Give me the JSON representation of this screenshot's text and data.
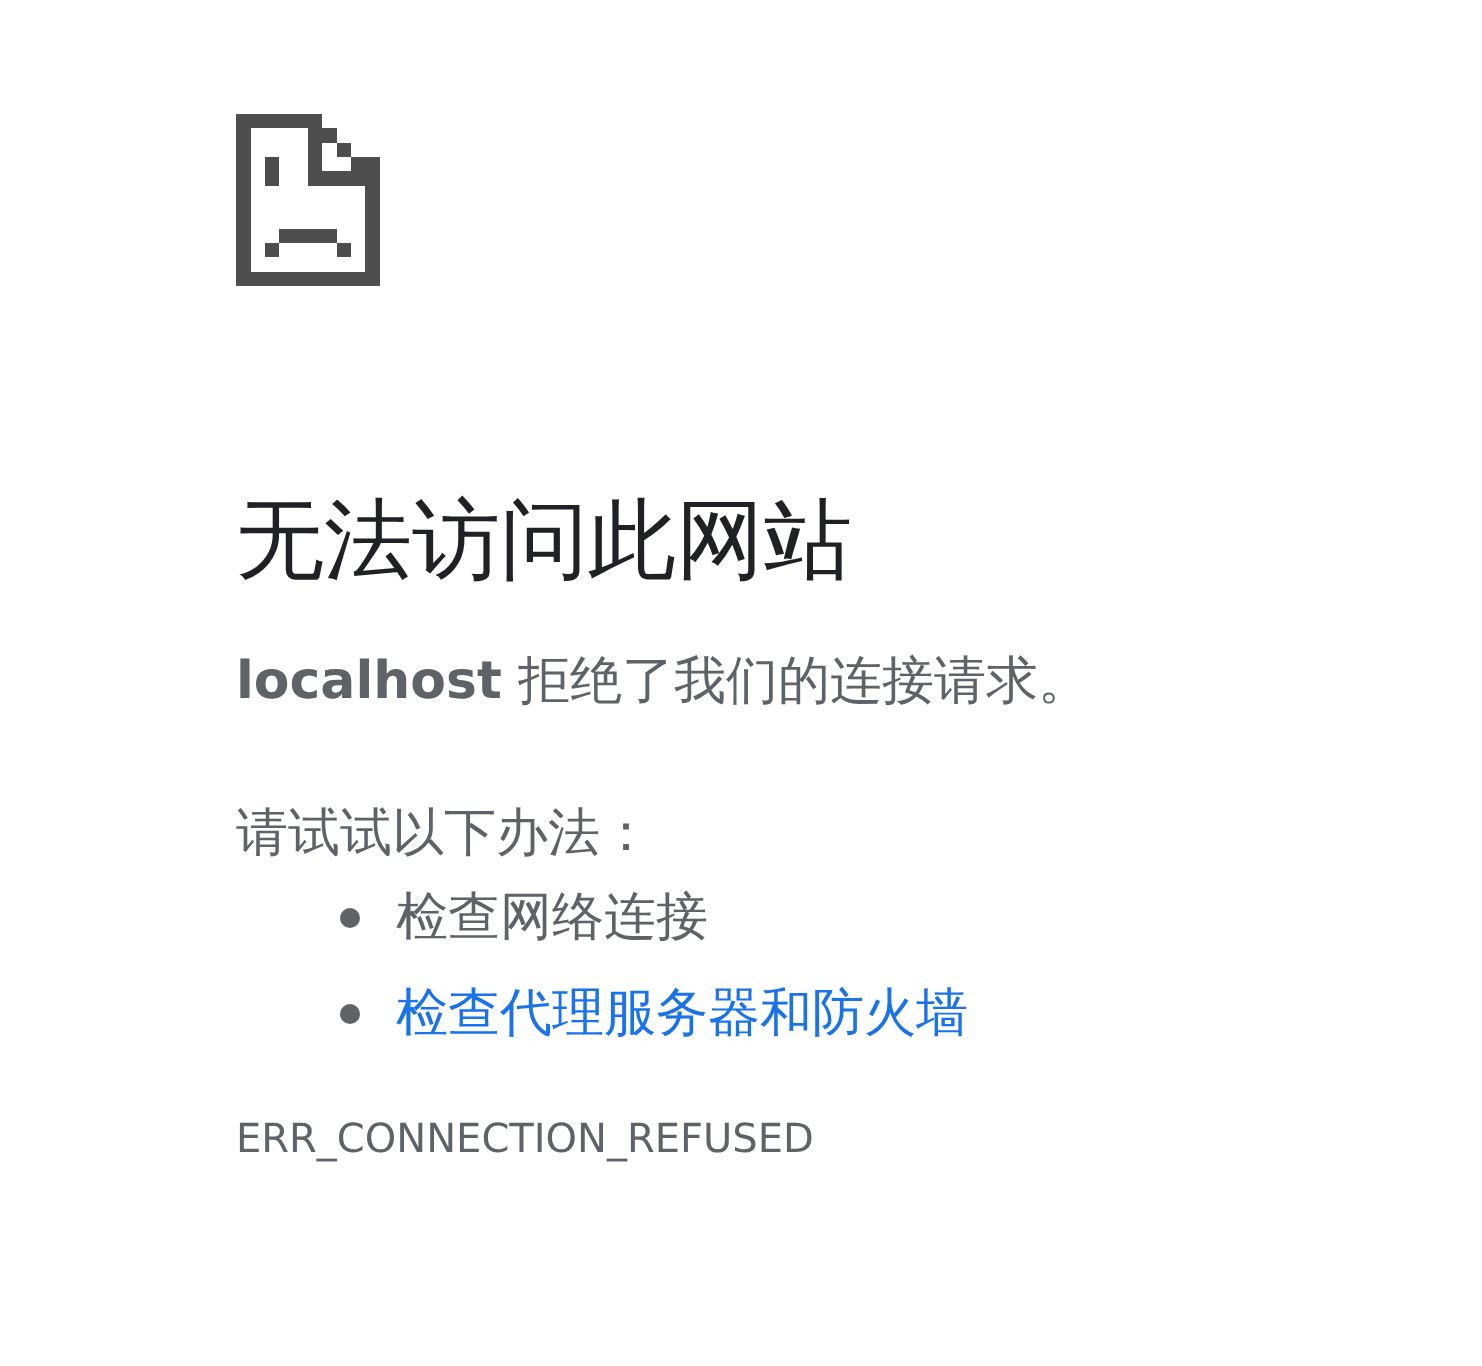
{
  "title": "无法访问此网站",
  "message": "**localhost** 拒绝了我们的连接请求。",
  "suggestions_heading": "请试试以下办法：",
  "suggestions": [
    {
      "text": "检查网络连接",
      "kind": "text"
    },
    {
      "text": "检查代理服务器和防火墙",
      "kind": "link"
    }
  ],
  "error_code": "ERR_CONNECTION_REFUSED"
}
